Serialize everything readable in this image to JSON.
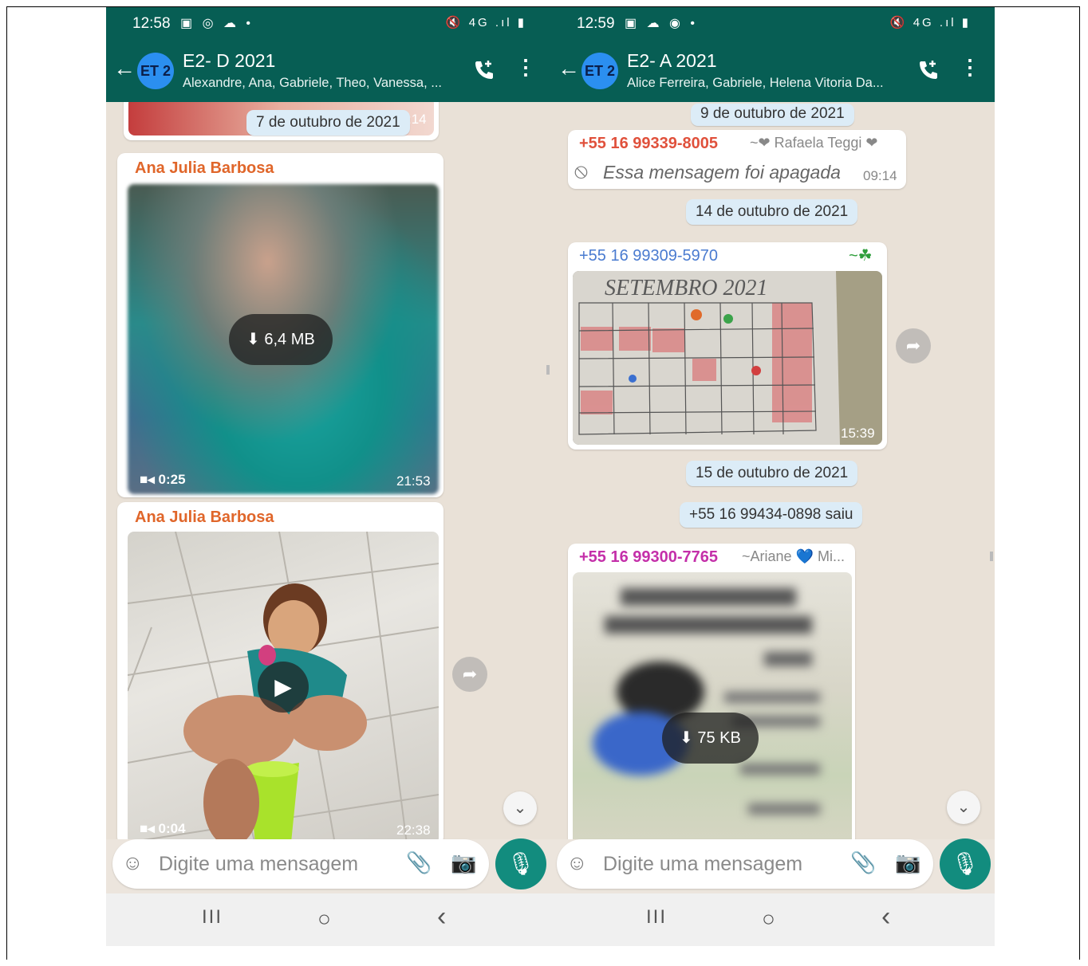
{
  "phones": [
    {
      "status": {
        "time": "12:58",
        "left_icons": "▣ ◎ ☁ •",
        "right_icons": "🔇 4G .ıl ▮"
      },
      "header": {
        "back": "←",
        "avatar": "ET 2",
        "title": "E2- D 2021",
        "subtitle": "Alexandre, Ana, Gabriele, Theo, Vanessa, ...",
        "call_icon": "phone-add-icon",
        "more": "⋮"
      },
      "date_pill": "7 de outubro de 2021",
      "partial_time": ":14",
      "messages": [
        {
          "sender": "Ana Julia Barbosa",
          "size": "6,4 MB",
          "duration": "0:25",
          "time": "21:53"
        },
        {
          "sender": "Ana Julia Barbosa",
          "duration": "0:04",
          "time": "22:38"
        }
      ],
      "input": {
        "placeholder": "Digite uma mensagem"
      },
      "nav": {
        "recent": "III",
        "home": "○",
        "back": "‹"
      }
    },
    {
      "status": {
        "time": "12:59",
        "left_icons": "▣ ☁ ◉ •",
        "right_icons": "🔇 4G .ıl ▮"
      },
      "header": {
        "back": "←",
        "avatar": "ET 2",
        "title": "E2- A 2021",
        "subtitle": "Alice Ferreira, Gabriele, Helena Vitoria Da...",
        "call_icon": "phone-add-icon",
        "more": "⋮"
      },
      "date_pill_1": "9 de outubro de 2021",
      "deleted_msg": {
        "phone": "+55 16 99339-8005",
        "name": "~❤ Rafaela Teggi ❤",
        "text": "Essa mensagem foi apagada",
        "time": "09:14"
      },
      "date_pill_2": "14 de outubro de 2021",
      "image_msg": {
        "phone": "+55 16 99309-5970",
        "name": "~☘",
        "time": "15:39",
        "caption_in_image": "SETEMBRO 2021"
      },
      "date_pill_3": "15 de outubro de 2021",
      "system_msg": "+55 16 99434-0898 saiu",
      "last_msg": {
        "phone": "+55 16 99300-7765",
        "name": "~Ariane 💙 Mi...",
        "size": "75 KB"
      },
      "input": {
        "placeholder": "Digite uma mensagem"
      },
      "nav": {
        "recent": "III",
        "home": "○",
        "back": "‹"
      }
    }
  ],
  "colors": {
    "header": "#075e54",
    "accent": "#128c7e",
    "sender_orange": "#e0662a",
    "sender_blue": "#4a7bd0",
    "sender_red": "#e0513c",
    "sender_magenta": "#c42fa9"
  }
}
